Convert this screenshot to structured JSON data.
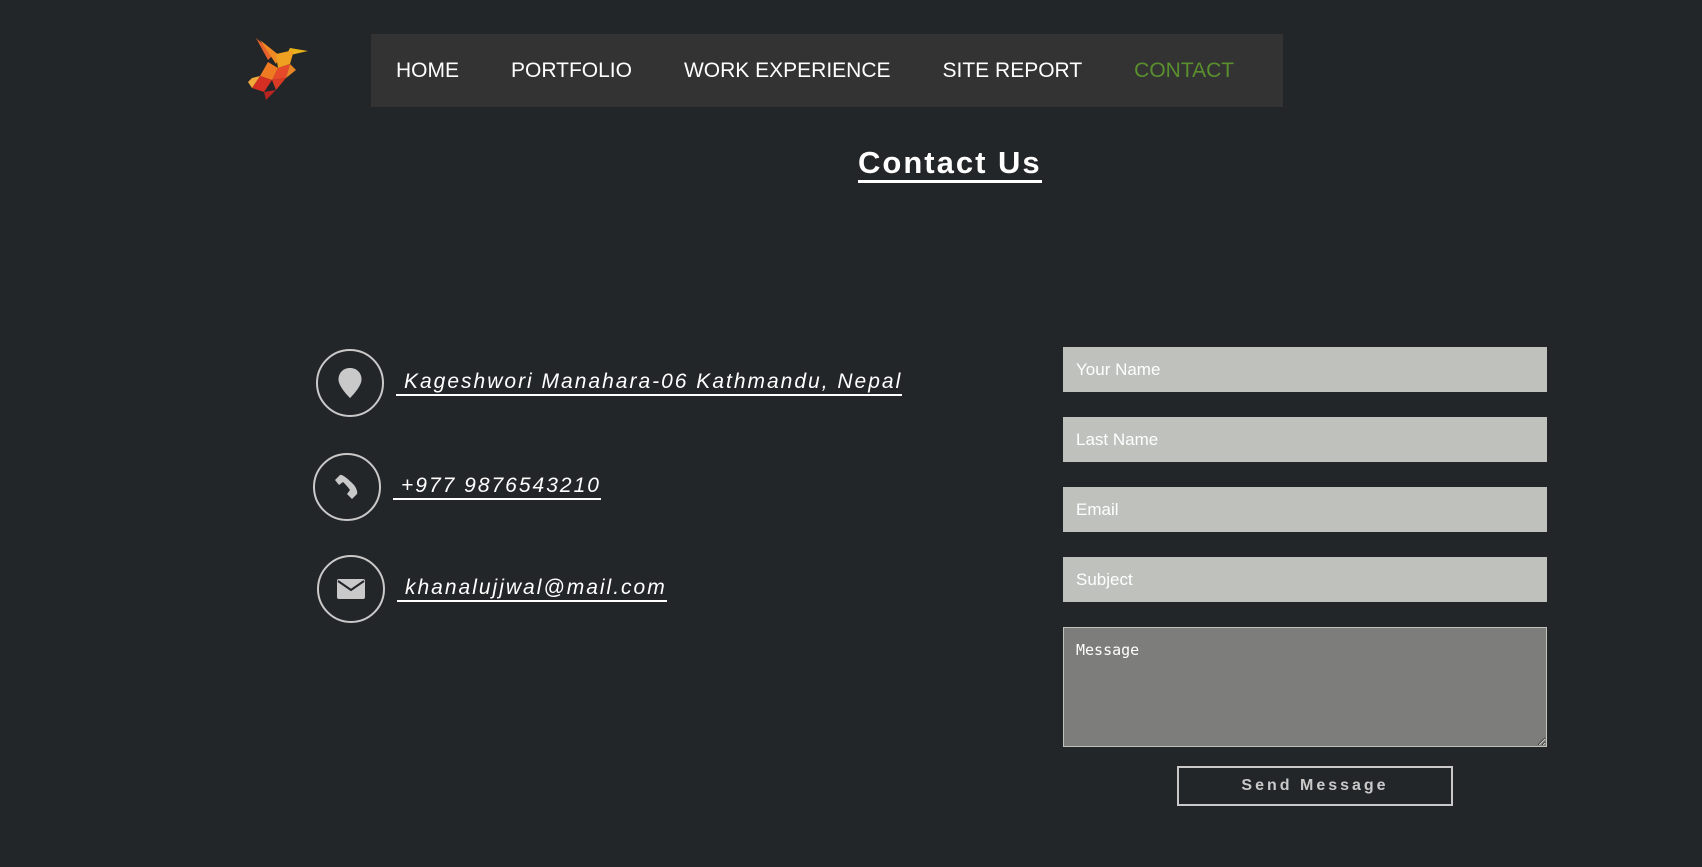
{
  "nav": {
    "items": [
      {
        "label": "HOME",
        "active": false
      },
      {
        "label": "PORTFOLIO",
        "active": false
      },
      {
        "label": "WORK EXPERIENCE",
        "active": false
      },
      {
        "label": "SITE REPORT",
        "active": false
      },
      {
        "label": "CONTACT",
        "active": true
      }
    ],
    "active_color": "#5a8f2e"
  },
  "page_title": "Contact Us",
  "contact_info": {
    "address": " Kageshwori Manahara-06 Kathmandu, Nepal",
    "phone": " +977 9876543210",
    "email": " khanalujjwal@mail.com",
    "icons": [
      "location-pin-icon",
      "phone-icon",
      "envelope-icon"
    ]
  },
  "form": {
    "name_placeholder": "Your Name",
    "lastname_placeholder": "Last Name",
    "email_placeholder": "Email",
    "subject_placeholder": "Subject",
    "message_placeholder": "Message",
    "send_label": "Send Message"
  },
  "colors": {
    "background": "#232629",
    "nav_background": "#333333",
    "field_background": "#bfc1bd",
    "message_background": "#7d7d7b"
  }
}
